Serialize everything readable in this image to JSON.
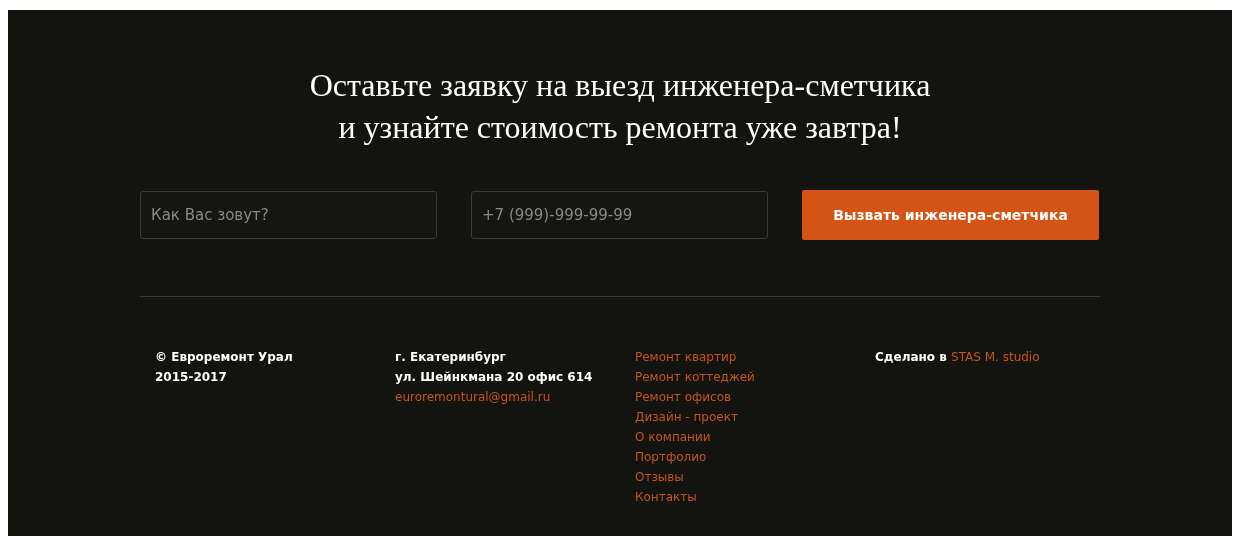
{
  "heading": {
    "lines": [
      "Оставьте заявку на выезд инженера-сметчика",
      "и узнайте стоимость ремонта уже завтра!"
    ]
  },
  "form": {
    "name_field": {
      "placeholder": "Как Вас зовут?"
    },
    "phone_field": {
      "placeholder": "+7 (999)-999-99-99"
    },
    "submit": "Вызвать инженера-сметчика"
  },
  "footer": {
    "copyright": [
      "© Евроремонт Урал",
      "2015-2017"
    ],
    "address": [
      "г. Екатеринбург",
      "ул. Шейнкмана 20 офис 614"
    ],
    "email": "euroremontural@gmail.ru",
    "menu": [
      "Ремонт квартир",
      "Ремонт коттеджей",
      "Ремонт офисов",
      "Дизайн - проект",
      "О компании",
      "Портфолио",
      "Отзывы",
      "Контакты"
    ],
    "credit": {
      "text": "Сделано в",
      "link": "STAS M. studio"
    }
  }
}
